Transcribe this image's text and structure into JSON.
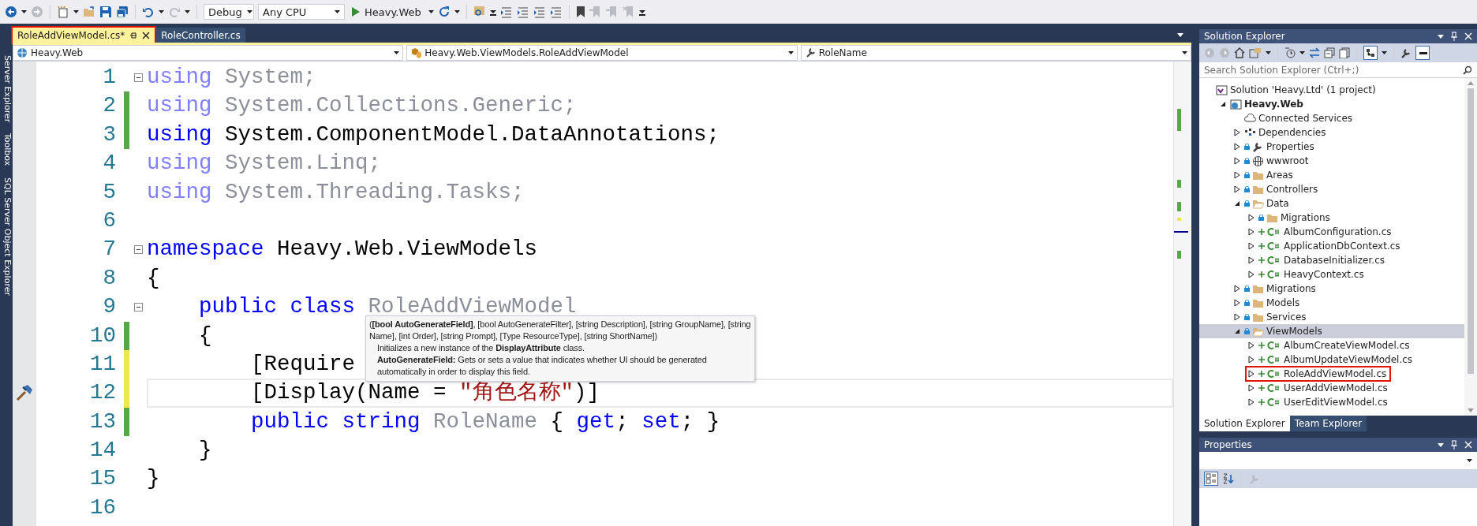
{
  "toolbar": {
    "configuration": "Debug",
    "platform": "Any CPU",
    "start_target": "Heavy.Web"
  },
  "side_tabs": [
    "Server Explorer",
    "Toolbox",
    "SQL Server Object Explorer"
  ],
  "tabs": [
    {
      "label": "RoleAddViewModel.cs*",
      "selected": true,
      "highlighted": true
    },
    {
      "label": "RoleController.cs",
      "selected": false,
      "highlighted": false
    }
  ],
  "nav_bar": {
    "project": "Heavy.Web",
    "type": "Heavy.Web.ViewModels.RoleAddViewModel",
    "member": "RoleName"
  },
  "code_lines": [
    {
      "number": "1",
      "modified": false,
      "fold_expanded": true,
      "tokens": [
        {
          "kind": "keyword_faded",
          "text": "using"
        },
        {
          "kind": "faded",
          "text": " System;"
        }
      ]
    },
    {
      "number": "2",
      "modified": true,
      "saved": true,
      "tokens": [
        {
          "kind": "keyword_faded",
          "text": "using"
        },
        {
          "kind": "faded",
          "text": " System.Collections.Generic;"
        }
      ]
    },
    {
      "number": "3",
      "modified": true,
      "saved": true,
      "tokens": [
        {
          "kind": "keyword",
          "text": "using"
        },
        {
          "kind": "plain",
          "text": " System.ComponentModel.DataAnnotations;"
        }
      ]
    },
    {
      "number": "4",
      "modified": false,
      "tokens": [
        {
          "kind": "keyword_faded",
          "text": "using"
        },
        {
          "kind": "faded",
          "text": " System.Linq;"
        }
      ]
    },
    {
      "number": "5",
      "modified": false,
      "tokens": [
        {
          "kind": "keyword_faded",
          "text": "using"
        },
        {
          "kind": "faded",
          "text": " System.Threading.Tasks;"
        }
      ]
    },
    {
      "number": "6",
      "modified": false
    },
    {
      "number": "7",
      "modified": false,
      "fold_expanded": true,
      "tokens": [
        {
          "kind": "keyword",
          "text": "namespace"
        },
        {
          "kind": "plain",
          "text": " Heavy.Web.ViewModels"
        }
      ]
    },
    {
      "number": "8",
      "modified": false,
      "tokens": [
        {
          "kind": "plain",
          "text": "{"
        }
      ]
    },
    {
      "number": "9",
      "modified": false,
      "fold_expanded": true,
      "tokens": [
        {
          "kind": "keyword",
          "text": "    public class"
        },
        {
          "kind": "faded",
          "text": " RoleAddViewModel"
        }
      ]
    },
    {
      "number": "10",
      "modified": true,
      "saved": true,
      "tokens": [
        {
          "kind": "plain",
          "text": "    {"
        }
      ]
    },
    {
      "number": "11",
      "modified": true,
      "saved": false,
      "tokens": [
        {
          "kind": "plain",
          "text": "        [Require"
        }
      ]
    },
    {
      "number": "12",
      "modified": true,
      "saved": false,
      "current": true,
      "quick_actions": true,
      "tokens": [
        {
          "kind": "plain",
          "text": "        [Display(Name = "
        },
        {
          "kind": "string",
          "text": "\"角色名称\""
        },
        {
          "kind": "plain",
          "text": ")]"
        }
      ]
    },
    {
      "number": "13",
      "modified": true,
      "saved": true,
      "tokens": [
        {
          "kind": "keyword",
          "text": "        public string"
        },
        {
          "kind": "faded",
          "text": " RoleName"
        },
        {
          "kind": "plain",
          "text": " { "
        },
        {
          "kind": "keyword",
          "text": "get"
        },
        {
          "kind": "plain",
          "text": "; "
        },
        {
          "kind": "keyword",
          "text": "set"
        },
        {
          "kind": "plain",
          "text": "; }"
        }
      ]
    },
    {
      "number": "14",
      "modified": false,
      "tokens": [
        {
          "kind": "plain",
          "text": "    }"
        }
      ]
    },
    {
      "number": "15",
      "modified": false,
      "tokens": [
        {
          "kind": "plain",
          "text": "}"
        }
      ]
    },
    {
      "number": "16",
      "modified": false
    }
  ],
  "tooltip": {
    "signature": "(**[bool AutoGenerateField]**, [bool AutoGenerateFilter], [string Description], [string GroupName], [string Name], [int Order], [string Prompt], [Type ResourceType], [string ShortName])",
    "summary": "Initializes a new instance of the **DisplayAttribute** class.",
    "parameter": "**AutoGenerateField:** Gets or sets a value that indicates whether UI should be generated automatically in order to display this field."
  },
  "solution_explorer": {
    "title": "Solution Explorer",
    "search": {
      "placeholder": "Search Solution Explorer (Ctrl+;)"
    },
    "tree": [
      {
        "label": "Solution 'Heavy.Ltd' (1 project)",
        "kind": "solution",
        "expandable": false,
        "selected": false,
        "highlighted": false,
        "children": [
          {
            "label": "Heavy.Web",
            "kind": "project",
            "bold": true,
            "expandable": true,
            "expanded": true,
            "selected": false,
            "highlighted": false,
            "children": [
              {
                "label": "Connected Services",
                "kind": "cloud",
                "expandable": false,
                "selected": false,
                "highlighted": false
              },
              {
                "label": "Dependencies",
                "kind": "dependencies",
                "expandable": true,
                "expanded": false,
                "selected": false,
                "highlighted": false
              },
              {
                "label": "Properties",
                "kind": "wrench",
                "expandable": true,
                "expanded": false,
                "selected": false,
                "highlighted": false
              },
              {
                "label": "wwwroot",
                "kind": "globe",
                "expandable": true,
                "expanded": false,
                "selected": false,
                "highlighted": false
              },
              {
                "label": "Areas",
                "kind": "folder",
                "expandable": true,
                "expanded": false,
                "selected": false,
                "highlighted": false
              },
              {
                "label": "Controllers",
                "kind": "folder",
                "expandable": true,
                "expanded": false,
                "selected": false,
                "highlighted": false
              },
              {
                "label": "Data",
                "kind": "folder",
                "expandable": true,
                "expanded": true,
                "selected": false,
                "highlighted": false,
                "children": [
                  {
                    "label": "Migrations",
                    "kind": "folder",
                    "expandable": true,
                    "expanded": false,
                    "selected": false,
                    "highlighted": false
                  },
                  {
                    "label": "AlbumConfiguration.cs",
                    "kind": "csharp",
                    "expandable": true,
                    "expanded": false,
                    "selected": false,
                    "highlighted": false
                  },
                  {
                    "label": "ApplicationDbContext.cs",
                    "kind": "csharp",
                    "expandable": true,
                    "expanded": false,
                    "selected": false,
                    "highlighted": false
                  },
                  {
                    "label": "DatabaseInitializer.cs",
                    "kind": "csharp",
                    "expandable": true,
                    "expanded": false,
                    "selected": false,
                    "highlighted": false
                  },
                  {
                    "label": "HeavyContext.cs",
                    "kind": "csharp",
                    "expandable": true,
                    "expanded": false,
                    "selected": false,
                    "highlighted": false
                  }
                ]
              },
              {
                "label": "Migrations",
                "kind": "folder",
                "expandable": true,
                "expanded": false,
                "selected": false,
                "highlighted": false
              },
              {
                "label": "Models",
                "kind": "folder",
                "expandable": true,
                "expanded": false,
                "selected": false,
                "highlighted": false
              },
              {
                "label": "Services",
                "kind": "folder",
                "expandable": true,
                "expanded": false,
                "selected": false,
                "highlighted": false
              },
              {
                "label": "ViewModels",
                "kind": "folder",
                "expandable": true,
                "expanded": true,
                "selected": true,
                "highlighted": false,
                "children": [
                  {
                    "label": "AlbumCreateViewModel.cs",
                    "kind": "csharp",
                    "expandable": true,
                    "expanded": false,
                    "selected": false,
                    "highlighted": false
                  },
                  {
                    "label": "AlbumUpdateViewModel.cs",
                    "kind": "csharp",
                    "expandable": true,
                    "expanded": false,
                    "selected": false,
                    "highlighted": false
                  },
                  {
                    "label": "RoleAddViewModel.cs",
                    "kind": "csharp",
                    "expandable": true,
                    "expanded": false,
                    "selected": false,
                    "highlighted": true
                  },
                  {
                    "label": "UserAddViewModel.cs",
                    "kind": "csharp",
                    "expandable": true,
                    "expanded": false,
                    "selected": false,
                    "highlighted": false
                  },
                  {
                    "label": "UserEditViewModel.cs",
                    "kind": "csharp",
                    "expandable": true,
                    "expanded": false,
                    "selected": false,
                    "highlighted": false
                  }
                ]
              }
            ]
          }
        ]
      }
    ],
    "bottom_tabs": [
      {
        "label": "Solution Explorer",
        "selected": true
      },
      {
        "label": "Team Explorer",
        "selected": false
      }
    ]
  },
  "properties": {
    "title": "Properties"
  }
}
